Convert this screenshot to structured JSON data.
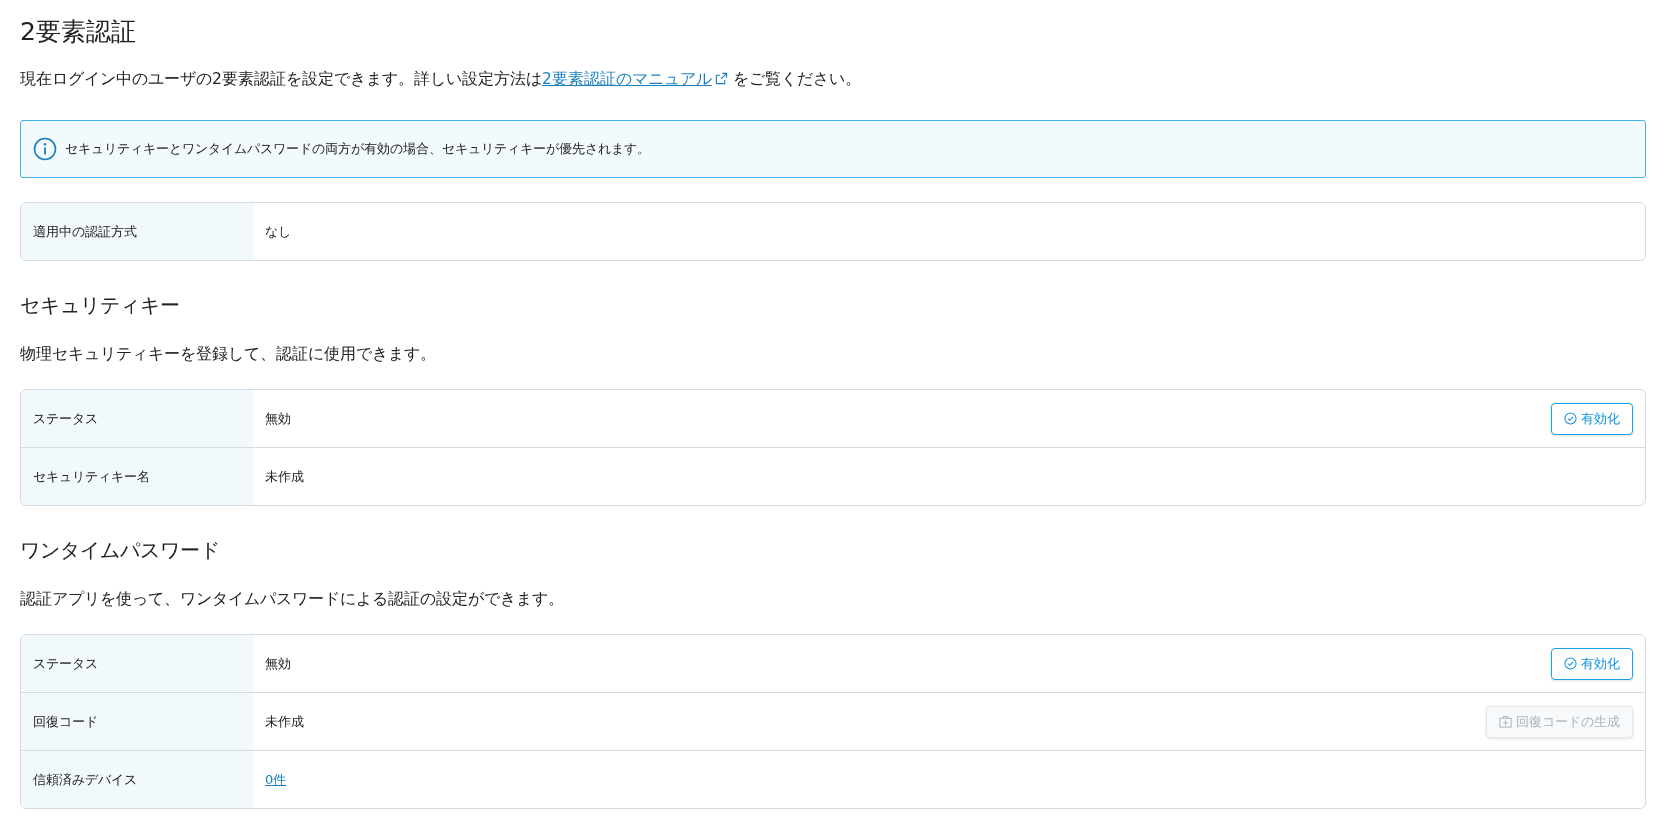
{
  "page_title": "2要素認証",
  "intro": {
    "text_before": "現在ログイン中のユーザの2要素認証を設定できます。詳しい設定方法は",
    "link": "2要素認証のマニュアル",
    "text_after": "をご覧ください。"
  },
  "notice": "セキュリティキーとワンタイムパスワードの両方が有効の場合、セキュリティキーが優先されます。",
  "summary": {
    "rows": [
      {
        "label": "適用中の認証方式",
        "value": "なし",
        "kind": "text"
      }
    ]
  },
  "sections": [
    {
      "title": "セキュリティキー",
      "description": "物理セキュリティキーを登録して、認証に使用できます。",
      "rows": [
        {
          "label": "ステータス",
          "value": "無効",
          "kind": "text",
          "button": {
            "label": "有効化",
            "kind": "enable",
            "disabled": false
          }
        },
        {
          "label": "セキュリティキー名",
          "value": "未作成",
          "kind": "text"
        }
      ]
    },
    {
      "title": "ワンタイムパスワード",
      "description": "認証アプリを使って、ワンタイムパスワードによる認証の設定ができます。",
      "rows": [
        {
          "label": "ステータス",
          "value": "無効",
          "kind": "text",
          "button": {
            "label": "有効化",
            "kind": "enable",
            "disabled": false
          }
        },
        {
          "label": "回復コード",
          "value": "未作成",
          "kind": "text",
          "button": {
            "label": "回復コードの生成",
            "kind": "generate",
            "disabled": true
          }
        },
        {
          "label": "信頼済みデバイス",
          "value": "0件",
          "kind": "link"
        }
      ]
    }
  ]
}
